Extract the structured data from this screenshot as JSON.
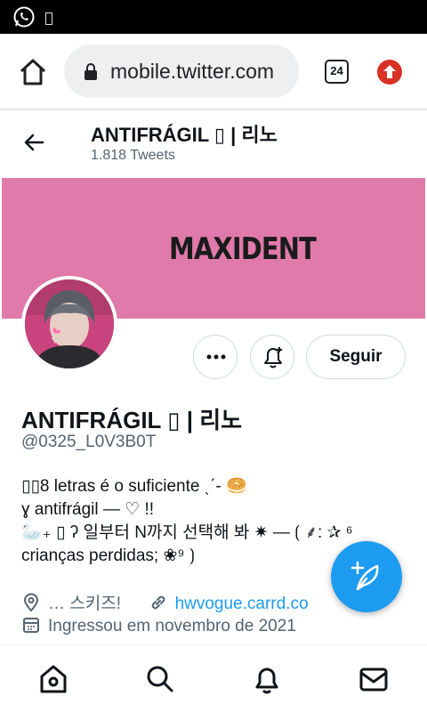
{
  "status_bar": {
    "icons": [
      "whatsapp-icon",
      "notification-placeholder-glyph"
    ]
  },
  "browser": {
    "url": "mobile.twitter.com",
    "tab_count": "24",
    "icons": [
      "home-icon",
      "lock-icon",
      "tab-switcher-icon",
      "update-arrow-icon"
    ],
    "accent_update_color": "#d93025"
  },
  "header": {
    "name": "ANTIFRÁGIL ▯ | 리노",
    "tweet_count": "1.818 Tweets"
  },
  "banner": {
    "logo_text": "MAXIDENT",
    "color": "#e07aab"
  },
  "actions": {
    "follow_label": "Seguir"
  },
  "profile": {
    "name": "ANTIFRÁGIL ▯ | 리노",
    "handle": "@0325_L0V3B0T",
    "bio": [
      "▯▯8 letras é o suficiente ˎˊ- 🥯",
      "ɣ antifrágil — ♡ !!",
      "🦢₊ ▯ ʔ 일부터 N까지 선택해 봐 ✷ — ⟮ ⸙: ✰ ⁶",
      "crianças perdidas; ❀⁹ ⟯"
    ],
    "location": "… 스키즈!",
    "website": "hwvogue.carrd.co",
    "joined": "Ingressou em novembro de 2021"
  },
  "colors": {
    "twitter_blue": "#1d9bf0",
    "secondary_text": "#536471"
  }
}
